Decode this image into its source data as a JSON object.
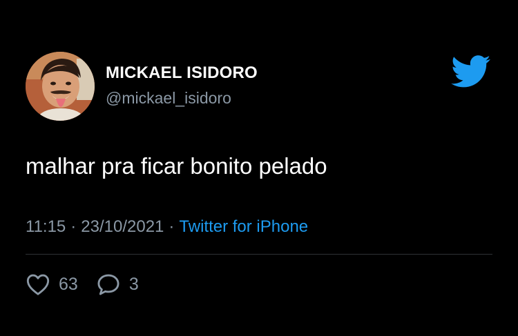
{
  "tweet": {
    "author": {
      "display_name": "MICKAEL ISIDORO",
      "handle": "@mickael_isidoro"
    },
    "text": "malhar pra ficar bonito pelado",
    "time": "11:15",
    "date": "23/10/2021",
    "separator": "·",
    "source": "Twitter for iPhone",
    "likes": "63",
    "replies": "3"
  },
  "icons": {
    "logo": "twitter-bird-icon",
    "like": "heart-icon",
    "reply": "speech-bubble-icon"
  },
  "colors": {
    "background": "#000000",
    "primary_text": "#ffffff",
    "secondary_text": "#8b98a5",
    "accent": "#1d9bf0",
    "divider": "#2f3336"
  }
}
